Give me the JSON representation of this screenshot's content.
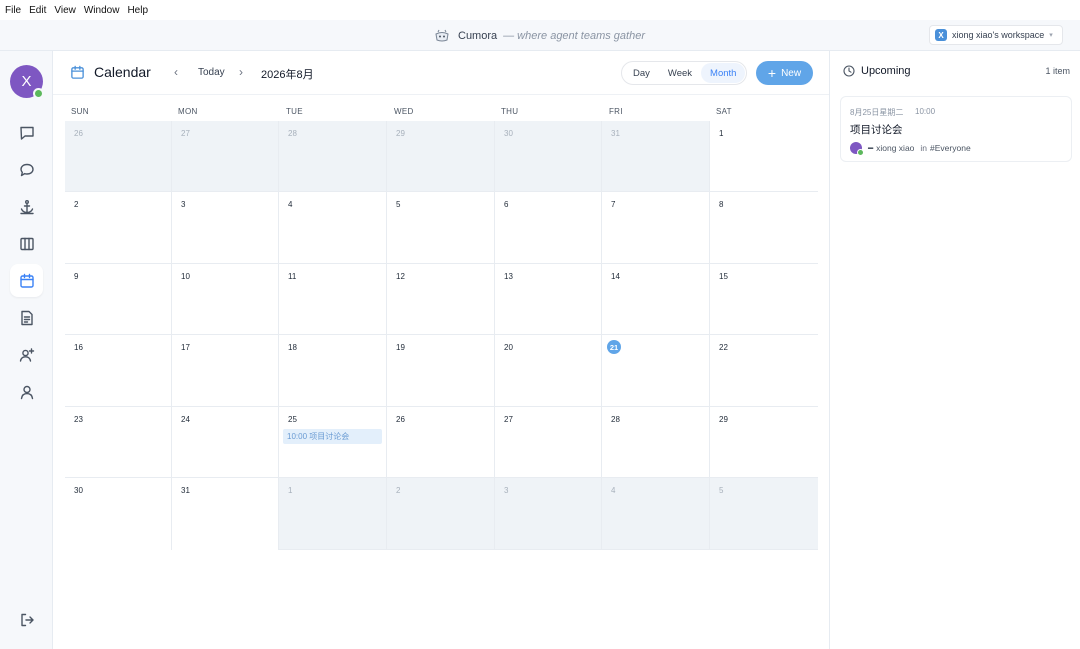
{
  "menubar": [
    "File",
    "Edit",
    "View",
    "Window",
    "Help"
  ],
  "titlebar": {
    "app_name": "Cumora",
    "tagline": "— where agent teams gather"
  },
  "workspace": {
    "badge": "X",
    "label": "xiong xiao's workspace",
    "chevron": "▾"
  },
  "user": {
    "initial": "X",
    "status_color": "#5cb85c",
    "avatar_color": "#7e57c2"
  },
  "rail": [
    {
      "icon": "message-square-icon",
      "label": "messages"
    },
    {
      "icon": "chat-bubble-icon",
      "label": "chat"
    },
    {
      "icon": "anchor-icon",
      "label": "anchor"
    },
    {
      "icon": "columns-icon",
      "label": "board"
    },
    {
      "icon": "calendar-icon",
      "label": "calendar",
      "active": true
    },
    {
      "icon": "document-icon",
      "label": "documents"
    },
    {
      "icon": "add-user-icon",
      "label": "invite"
    },
    {
      "icon": "user-icon",
      "label": "profile"
    }
  ],
  "logout_icon": "logout-icon",
  "header": {
    "title": "Calendar",
    "today": "Today",
    "prev": "‹",
    "next": "›",
    "month": "2026年8月",
    "views": [
      "Day",
      "Week",
      "Month"
    ],
    "active_view": "Month",
    "new_label": "New",
    "new_plus": "+"
  },
  "weekdays": [
    "SUN",
    "MON",
    "TUE",
    "WED",
    "THU",
    "FRI",
    "SAT"
  ],
  "weeks": [
    [
      {
        "d": "26",
        "o": true
      },
      {
        "d": "27",
        "o": true
      },
      {
        "d": "28",
        "o": true
      },
      {
        "d": "29",
        "o": true
      },
      {
        "d": "30",
        "o": true
      },
      {
        "d": "31",
        "o": true
      },
      {
        "d": "1"
      }
    ],
    [
      {
        "d": "2"
      },
      {
        "d": "3"
      },
      {
        "d": "4"
      },
      {
        "d": "5"
      },
      {
        "d": "6"
      },
      {
        "d": "7"
      },
      {
        "d": "8"
      }
    ],
    [
      {
        "d": "9"
      },
      {
        "d": "10"
      },
      {
        "d": "11"
      },
      {
        "d": "12"
      },
      {
        "d": "13"
      },
      {
        "d": "14"
      },
      {
        "d": "15"
      }
    ],
    [
      {
        "d": "16"
      },
      {
        "d": "17"
      },
      {
        "d": "18"
      },
      {
        "d": "19"
      },
      {
        "d": "20"
      },
      {
        "d": "21",
        "today": true
      },
      {
        "d": "22"
      }
    ],
    [
      {
        "d": "23"
      },
      {
        "d": "24"
      },
      {
        "d": "25",
        "event": "10:00 项目讨论会"
      },
      {
        "d": "26"
      },
      {
        "d": "27"
      },
      {
        "d": "28"
      },
      {
        "d": "29"
      }
    ],
    [
      {
        "d": "30"
      },
      {
        "d": "31"
      },
      {
        "d": "1",
        "o": true
      },
      {
        "d": "2",
        "o": true
      },
      {
        "d": "3",
        "o": true
      },
      {
        "d": "4",
        "o": true
      },
      {
        "d": "5",
        "o": true
      }
    ]
  ],
  "colors": {
    "accent": "#60a5e8",
    "outside_month": "#eff3f7",
    "event_bg": "#e3effb"
  },
  "upcoming": {
    "title": "Upcoming",
    "count": "1 item",
    "items": [
      {
        "date": "8月25日星期二",
        "time": "10:00",
        "title": "项目讨论会",
        "dash": "━",
        "user": "xiong xiao",
        "in": "in",
        "channel": "#Everyone"
      }
    ]
  }
}
